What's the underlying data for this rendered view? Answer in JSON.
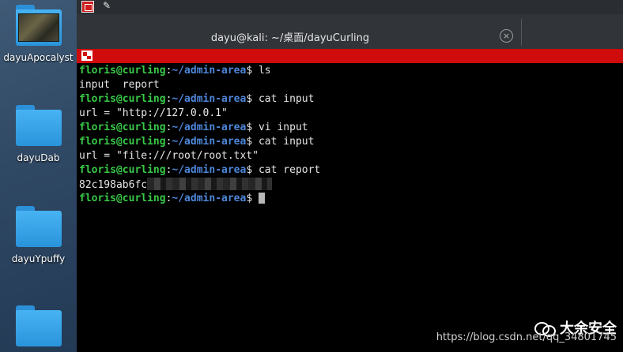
{
  "desktop": {
    "items": [
      {
        "label": "dayuApocalyst"
      },
      {
        "label": "dayuDab"
      },
      {
        "label": "dayuYpuffy"
      },
      {
        "label": ""
      }
    ]
  },
  "window": {
    "tab_title": "dayu@kali: ~/桌面/dayuCurling",
    "close_glyph": "×"
  },
  "terminal": {
    "lines": [
      {
        "user": "floris@curling",
        "path": "~/admin-area",
        "cmd": "$ ls"
      },
      {
        "out": "input  report"
      },
      {
        "user": "floris@curling",
        "path": "~/admin-area",
        "cmd": "$ cat input"
      },
      {
        "out": "url = \"http://127.0.0.1\""
      },
      {
        "user": "floris@curling",
        "path": "~/admin-area",
        "cmd": "$ vi input"
      },
      {
        "user": "floris@curling",
        "path": "~/admin-area",
        "cmd": "$ cat input"
      },
      {
        "out": "url = \"file:///root/root.txt\""
      },
      {
        "user": "floris@curling",
        "path": "~/admin-area",
        "cmd": "$ cat report"
      },
      {
        "out": "82c198ab6fc"
      },
      {
        "user": "floris@curling",
        "path": "~/admin-area",
        "cmd": "$ "
      }
    ]
  },
  "watermark": {
    "brand": "大余安全",
    "url": "https://blog.csdn.net/qq_34801745"
  },
  "icons": [
    "folder-icon",
    "terminal-app-icon",
    "pin-icon",
    "close-tab-icon",
    "wechat-icon"
  ]
}
